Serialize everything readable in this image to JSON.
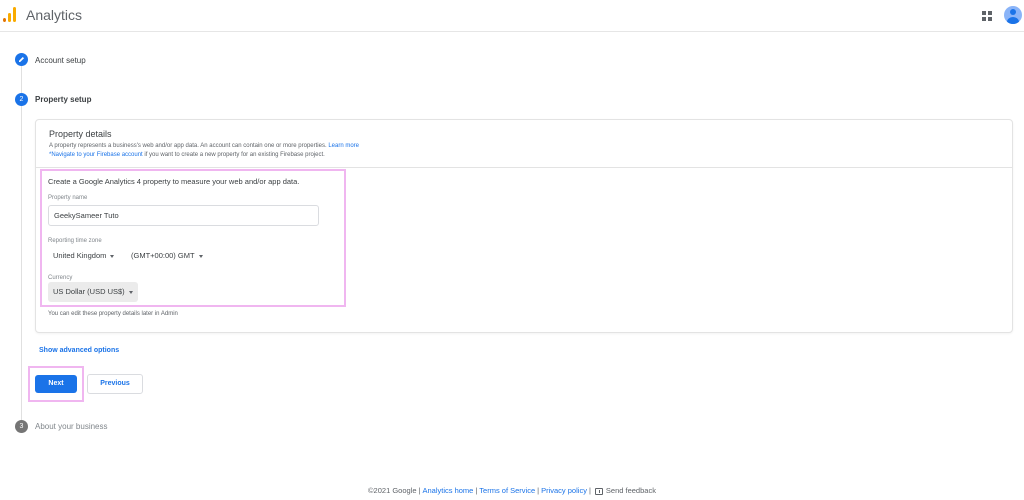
{
  "header": {
    "app_title": "Analytics",
    "icons": [
      "analytics-logo-icon",
      "apps-grid-icon",
      "account-avatar-icon"
    ]
  },
  "steps": [
    {
      "number": "",
      "label": "Account setup",
      "state": "completed",
      "icon": "edit-pencil-icon"
    },
    {
      "number": "2",
      "label": "Property setup",
      "state": "active"
    },
    {
      "number": "3",
      "label": "About your business",
      "state": "upcoming"
    }
  ],
  "card": {
    "title": "Property details",
    "desc_line1": "A property represents a business's web and/or app data. An account can contain one or more properties.",
    "learn_more": "Learn more",
    "firebase_link": "*Navigate to your Firebase account",
    "desc_line2_rest": " if you want to create a new property for an existing Firebase project."
  },
  "form": {
    "intro": "Create a Google Analytics 4 property to measure your web and/or app data.",
    "property_name_label": "Property name",
    "property_name_value": "GeekySameer Tuto",
    "timezone_label": "Reporting time zone",
    "timezone_country": "United Kingdom",
    "timezone_value": "(GMT+00:00) GMT",
    "currency_label": "Currency",
    "currency_value": "US Dollar (USD US$)",
    "hint": "You can edit these property details later in Admin"
  },
  "actions": {
    "advanced": "Show advanced options",
    "next": "Next",
    "previous": "Previous"
  },
  "footer": {
    "copyright": "©2021 Google",
    "links": [
      "Analytics home",
      "Terms of Service",
      "Privacy policy"
    ],
    "feedback": "Send feedback"
  },
  "colors": {
    "accent": "#1a73e8",
    "highlight": "#f0b6f0"
  }
}
